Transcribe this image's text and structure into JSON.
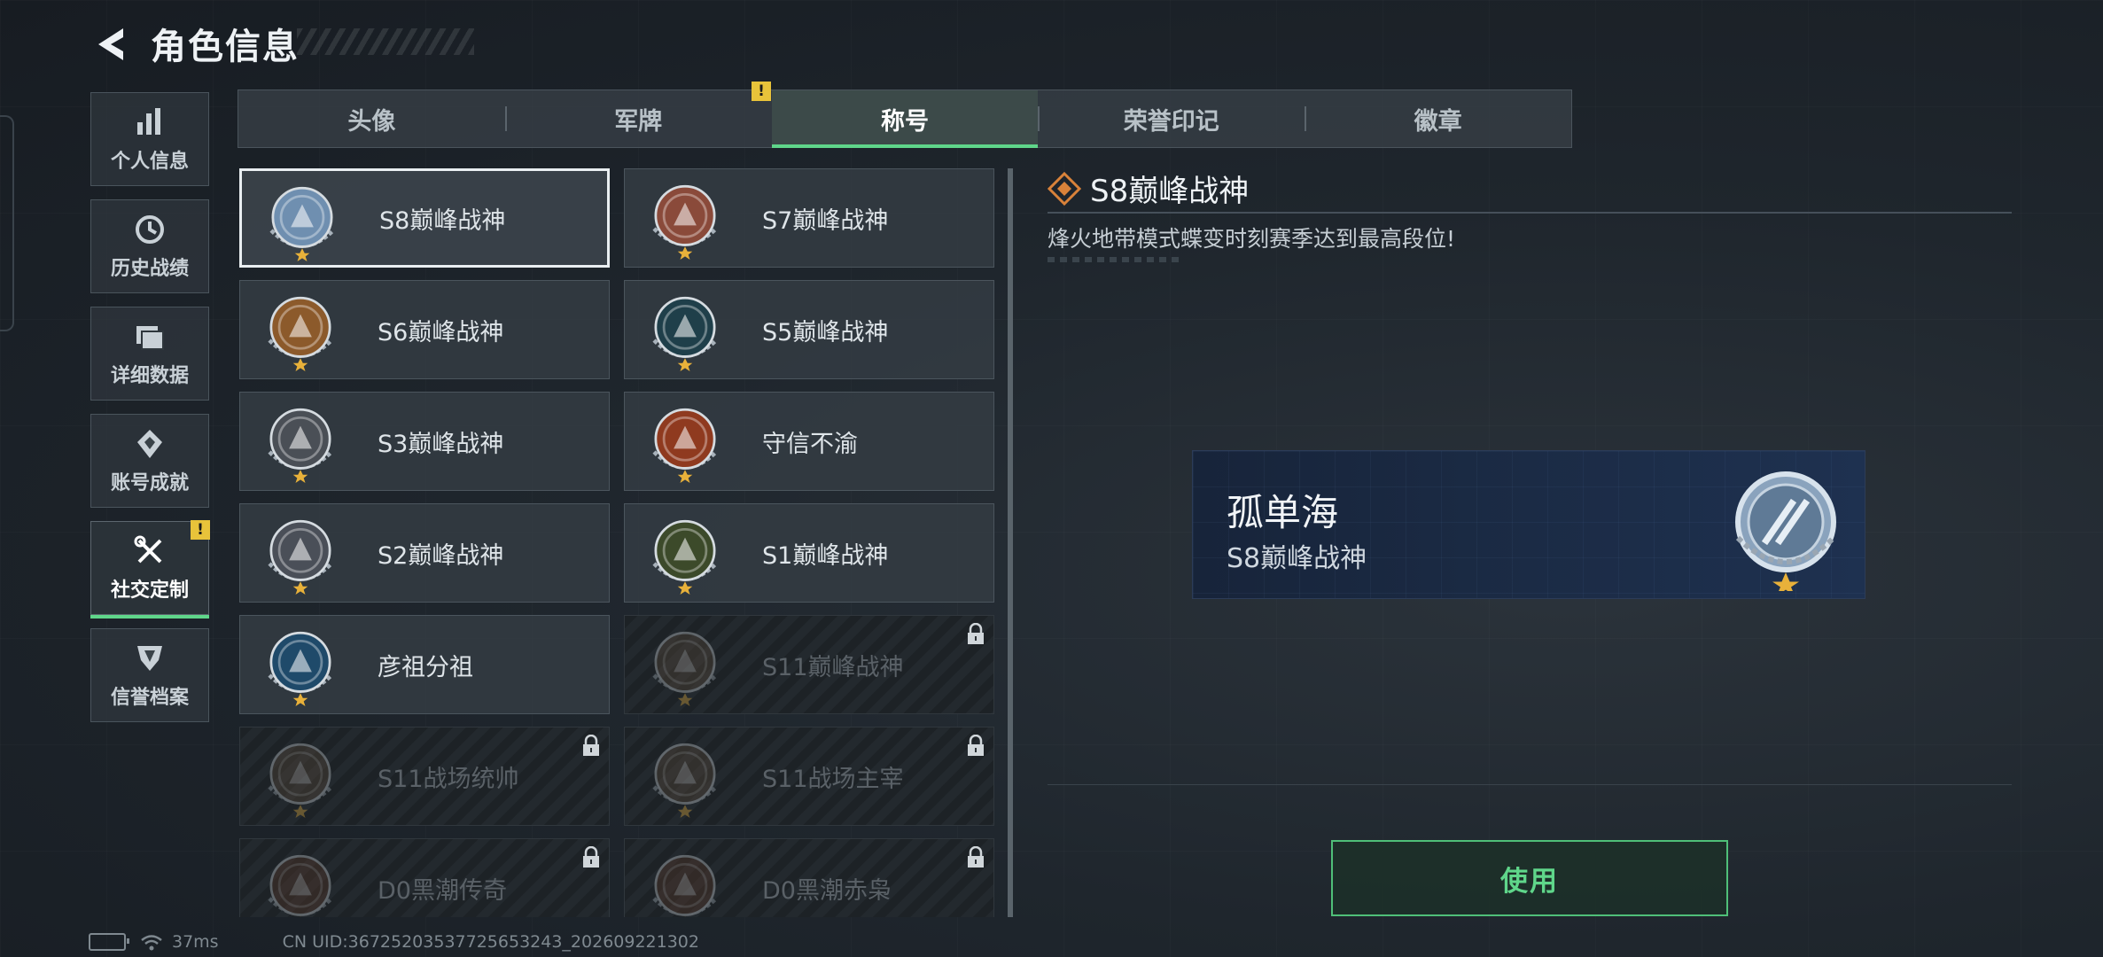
{
  "header": {
    "title": "角色信息"
  },
  "sidebar": {
    "items": [
      {
        "label": "个人信息",
        "icon": "bar-chart-icon"
      },
      {
        "label": "历史战绩",
        "icon": "clock-history-icon"
      },
      {
        "label": "详细数据",
        "icon": "folder-icon"
      },
      {
        "label": "账号成就",
        "icon": "achievement-icon"
      },
      {
        "label": "社交定制",
        "icon": "wrench-screwdriver-icon",
        "active": true,
        "badge": "!"
      },
      {
        "label": "信誉档案",
        "icon": "shield-icon"
      }
    ]
  },
  "tabs": {
    "items": [
      {
        "label": "头像"
      },
      {
        "label": "军牌"
      },
      {
        "label": "称号",
        "active": true
      },
      {
        "label": "荣誉印记"
      },
      {
        "label": "徽章"
      }
    ],
    "badge": "!"
  },
  "titles": [
    {
      "name": "S8巅峰战神",
      "selected": true,
      "locked": false,
      "color": "#6f8fb0"
    },
    {
      "name": "S7巅峰战神",
      "locked": false,
      "color": "#8a4a3a"
    },
    {
      "name": "S6巅峰战神",
      "locked": false,
      "color": "#8c5a2b"
    },
    {
      "name": "S5巅峰战神",
      "locked": false,
      "color": "#1f3f4a"
    },
    {
      "name": "S3巅峰战神",
      "locked": false,
      "color": "#4a4f56"
    },
    {
      "name": "守信不渝",
      "locked": false,
      "color": "#8f3a1f"
    },
    {
      "name": "S2巅峰战神",
      "locked": false,
      "color": "#4a4f58"
    },
    {
      "name": "S1巅峰战神",
      "locked": false,
      "color": "#3c4a2a"
    },
    {
      "name": "彦祖分祖",
      "locked": false,
      "color": "#1f4a6a"
    },
    {
      "name": "S11巅峰战神",
      "locked": true,
      "color": "#5a4a3a"
    },
    {
      "name": "S11战场统帅",
      "locked": true,
      "color": "#5a4a3a"
    },
    {
      "name": "S11战场主宰",
      "locked": true,
      "color": "#5a4a3a"
    },
    {
      "name": "D0黑潮传奇",
      "locked": true,
      "color": "#5a3a2a"
    },
    {
      "name": "D0黑潮赤枭",
      "locked": true,
      "color": "#5a3a2a"
    }
  ],
  "detail": {
    "title": "S8巅峰战神",
    "description": "烽火地带模式蝶变时刻赛季达到最高段位!",
    "preview": {
      "player_name": "孤单海",
      "title": "S8巅峰战神"
    },
    "use_label": "使用"
  },
  "status": {
    "ping": "37ms",
    "uid": "CN UID:36725203537725653243_202609221302"
  },
  "colors": {
    "accent": "#5fd68a",
    "warning": "#e8c33a",
    "preview_bg": "#1b2b45"
  }
}
